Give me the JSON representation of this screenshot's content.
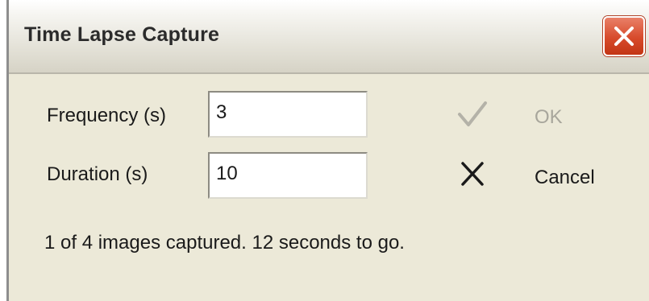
{
  "window": {
    "title": "Time Lapse Capture"
  },
  "form": {
    "frequency_label": "Frequency (s)",
    "frequency_value": "3",
    "duration_label": "Duration (s)",
    "duration_value": "10"
  },
  "buttons": {
    "ok_label": "OK",
    "ok_icon": "checkmark-icon",
    "ok_enabled": false,
    "cancel_label": "Cancel",
    "cancel_icon": "x-icon"
  },
  "status": {
    "text": "1 of 4 images captured. 12 seconds to go."
  },
  "colors": {
    "close_button": "#d74a2b",
    "dialog_background": "#ece9d8",
    "disabled_text": "#a8a69c"
  }
}
